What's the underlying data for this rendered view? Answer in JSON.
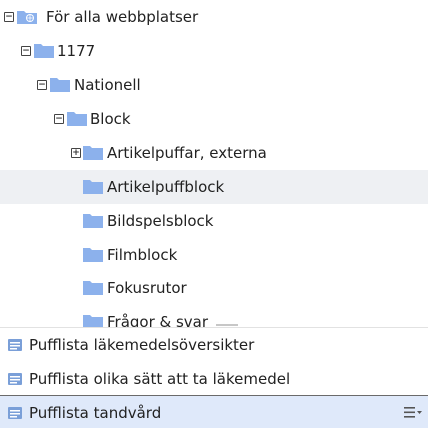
{
  "tree": {
    "nodes": [
      {
        "label": "För alla webbplatser",
        "toggle": "−",
        "icon": "globe-folder-icon"
      },
      {
        "label": "1177",
        "toggle": "−",
        "icon": "folder-icon"
      },
      {
        "label": "Nationell",
        "toggle": "−",
        "icon": "folder-icon"
      },
      {
        "label": "Block",
        "toggle": "−",
        "icon": "folder-icon"
      },
      {
        "label": "Artikelpuffar, externa",
        "toggle": "+",
        "icon": "folder-icon"
      },
      {
        "label": "Artikelpuffblock",
        "toggle": "",
        "icon": "folder-icon"
      },
      {
        "label": "Bildspelsblock",
        "toggle": "",
        "icon": "folder-icon"
      },
      {
        "label": "Filmblock",
        "toggle": "",
        "icon": "folder-icon"
      },
      {
        "label": "Fokusrutor",
        "toggle": "",
        "icon": "folder-icon"
      },
      {
        "label": "Frågor & svar",
        "toggle": "",
        "icon": "folder-icon"
      }
    ]
  },
  "pages": {
    "items": [
      {
        "label": "Pufflista läkemedelsöversikter",
        "icon": "page-list-icon"
      },
      {
        "label": "Pufflista olika sätt att ta läkemedel",
        "icon": "page-list-icon"
      },
      {
        "label": "Pufflista tandvård",
        "icon": "page-list-icon"
      }
    ],
    "context_menu_icon": "context-menu-icon"
  },
  "colors": {
    "folder": "#8cb1ec",
    "folder_tab": "#7aa2e3",
    "hover_row": "#eef0f3",
    "selected_row": "#dfe9fa",
    "page_icon": "#7a9fd8"
  }
}
